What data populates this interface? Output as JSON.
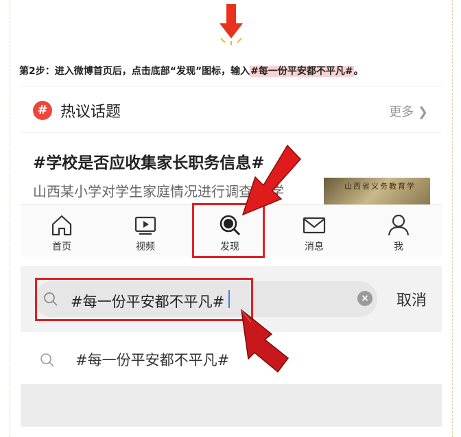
{
  "instruction": {
    "prefix": "第2步：进入微博首页后，点击底部“发现”图标，输入",
    "highlight": "#每一份平安都不平凡#",
    "suffix": "。"
  },
  "hot_topics": {
    "icon": "#",
    "title": "热议话题",
    "more": "更多",
    "headline": "#学校是否应收集家长职务信息#",
    "description": "山西某小学对学生家庭情况进行调查 把学",
    "thumbnail_text": "山西省义务教育学"
  },
  "tabbar": {
    "items": [
      {
        "label": "首页",
        "icon": "home-icon"
      },
      {
        "label": "视频",
        "icon": "video-icon"
      },
      {
        "label": "发现",
        "icon": "discover-icon"
      },
      {
        "label": "消息",
        "icon": "mail-icon"
      },
      {
        "label": "我",
        "icon": "profile-icon"
      }
    ]
  },
  "search": {
    "value": "#每一份平安都不平凡#",
    "cancel": "取消"
  },
  "suggestion": {
    "text": "#每一份平安都不平凡#"
  },
  "colors": {
    "accent": "#e12020",
    "topic_icon": "#f0453a",
    "highlight_bg": "#f8d3d3"
  }
}
